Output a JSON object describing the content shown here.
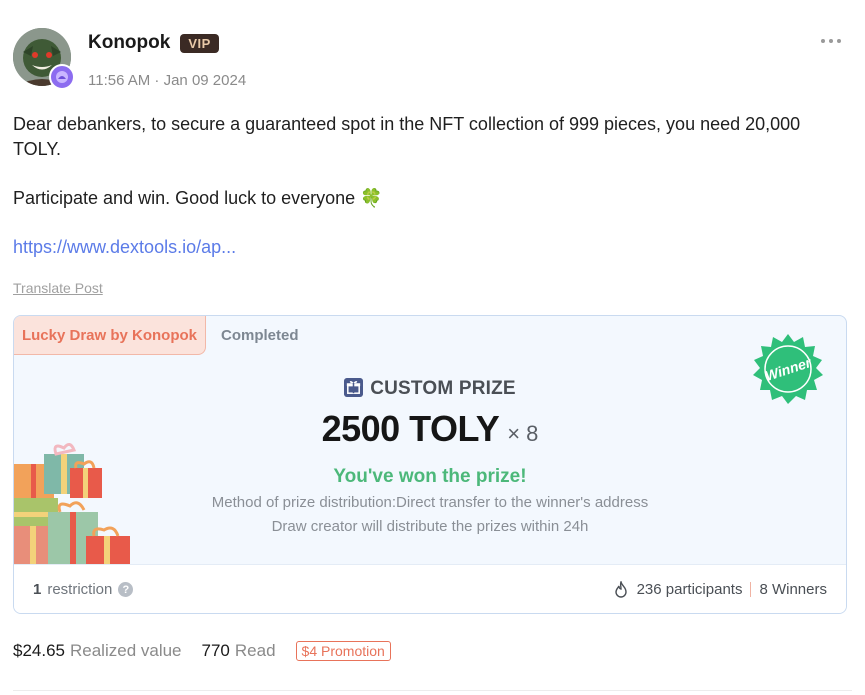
{
  "post": {
    "author": {
      "name": "Konopok",
      "badge": "VIP"
    },
    "timestamp": "11:56 AM · Jan 09 2024",
    "body": {
      "paragraph1": "Dear debankers, to secure a guaranteed spot in the NFT collection of 999 pieces, you need 20,000 TOLY.",
      "paragraph2": "Participate and win. Good luck to everyone ",
      "emoji": "🍀",
      "link": "https://www.dextools.io/ap..."
    },
    "translate_label": "Translate Post"
  },
  "lucky_draw": {
    "tab_label": "Lucky Draw by Konopok",
    "status": "Completed",
    "seal_text": "Winner",
    "prize_type": "CUSTOM PRIZE",
    "prize_amount": "2500 TOLY",
    "prize_multiplier": "× 8",
    "result": "You've won the prize!",
    "method": "Method of prize distribution:Direct transfer to the winner's address",
    "creator_note": "Draw creator will distribute the prizes within 24h",
    "restriction_count": "1",
    "restriction_label": "restriction",
    "participants": "236 participants",
    "winners": "8 Winners"
  },
  "stats_bar": {
    "realized_value": "$24.65",
    "realized_label": "Realized value",
    "read_count": "770",
    "read_label": "Read",
    "promotion": "$4 Promotion"
  },
  "colors": {
    "accent_orange": "#e8735a",
    "success_green": "#4cb87a",
    "link_blue": "#5b7be8",
    "seal_green": "#2fbf7a"
  }
}
